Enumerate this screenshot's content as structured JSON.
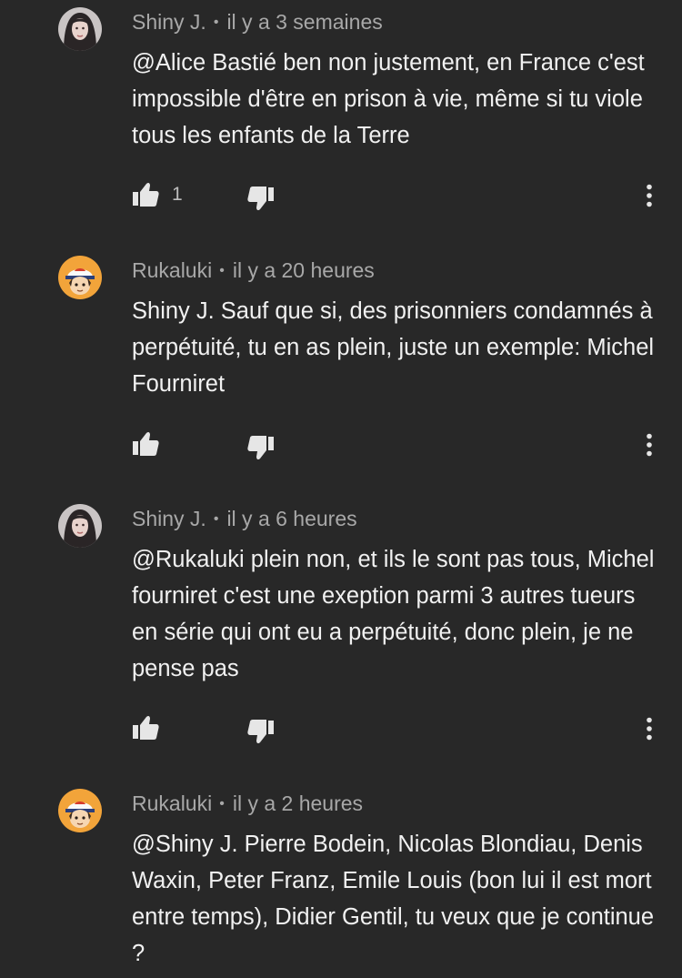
{
  "comments": [
    {
      "author": "Shiny J.",
      "separator": "•",
      "time": "il y a 3 semaines",
      "text": "@Alice Bastié ben non justement, en France c'est impossible d'être en prison à vie, même si tu viole tous les enfants de la Terre",
      "likes": "1",
      "avatar_icon": "avatar-woman-portrait-icon"
    },
    {
      "author": "Rukaluki",
      "separator": "•",
      "time": "il y a 20 heures",
      "text": "Shiny J. Sauf que si, des prisonniers condamnés à perpétuité, tu en as plein, juste un exemple: Michel Fourniret",
      "likes": "",
      "avatar_icon": "avatar-cartoon-trainer-icon"
    },
    {
      "author": "Shiny J.",
      "separator": "•",
      "time": "il y a 6 heures",
      "text": "@Rukaluki plein non, et ils le sont pas tous, Michel fourniret c'est une exeption parmi 3 autres tueurs en série qui ont eu a perpétuité, donc plein, je ne pense pas",
      "likes": "",
      "avatar_icon": "avatar-woman-portrait-icon"
    },
    {
      "author": "Rukaluki",
      "separator": "•",
      "time": "il y a 2 heures",
      "text": "@Shiny J. Pierre Bodein, Nicolas Blondiau, Denis Waxin, Peter Franz, Emile Louis (bon lui il est mort entre temps), Didier Gentil, tu veux que je continue ?",
      "likes": "",
      "avatar_icon": "avatar-cartoon-trainer-icon"
    }
  ],
  "colors": {
    "background": "#282828",
    "text": "#f1f1f1",
    "meta": "#a8a8a8",
    "icon": "#e6e6e6"
  }
}
